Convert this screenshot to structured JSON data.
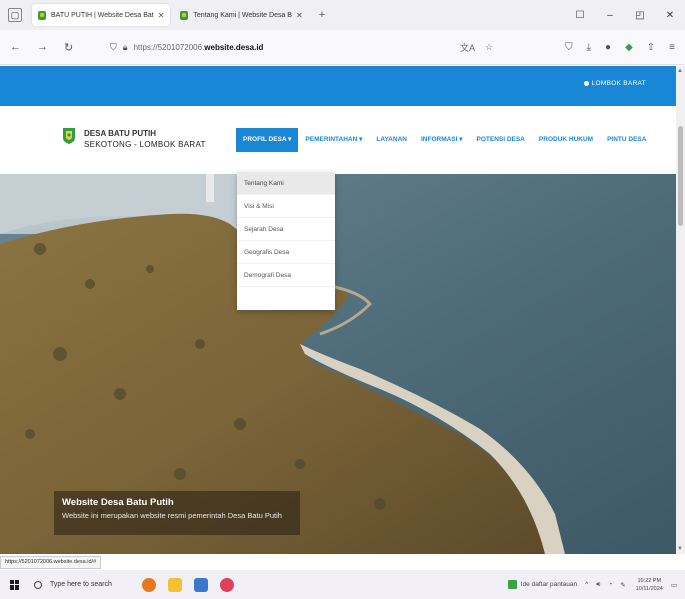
{
  "browser": {
    "tabs": [
      {
        "title": "BATU PUTIH | Website Desa Bat",
        "active": true
      },
      {
        "title": "Tentang Kami | Website Desa B",
        "active": false
      }
    ],
    "new_tab": "+",
    "url_prefix": "https://5201072006.",
    "url_host": "website.desa.id",
    "window_controls": [
      "–",
      "☐",
      "✕"
    ],
    "status_url": "https://5201072006.website.desa.id/#"
  },
  "site": {
    "region": "LOMBOK BARAT",
    "brand_line1": "DESA BATU PUTIH",
    "brand_line2": "SEKOTONG - LOMBOK BARAT",
    "menu": [
      {
        "label": "PROFIL DESA ▾",
        "active": true
      },
      {
        "label": "PEMERINTAHAN ▾",
        "active": false
      },
      {
        "label": "LAYANAN",
        "active": false
      },
      {
        "label": "INFORMASI ▾",
        "active": false
      },
      {
        "label": "POTENSI DESA",
        "active": false
      },
      {
        "label": "PRODUK HUKUM",
        "active": false
      },
      {
        "label": "PINTU DESA",
        "active": false
      }
    ],
    "dropdown": [
      {
        "label": "Tentang Kami",
        "hover": true
      },
      {
        "label": "Visi & Misi",
        "hover": false
      },
      {
        "label": "Sejarah Desa",
        "hover": false
      },
      {
        "label": "Geografis Desa",
        "hover": false
      },
      {
        "label": "Demografi Desa",
        "hover": false
      }
    ],
    "hero_title": "Website Desa Batu Putih",
    "hero_subtitle": "Website ini merupakan website resmi pemerintah Desa Batu Putih"
  },
  "taskbar": {
    "search_placeholder": "Type here to search",
    "news": "Ide daftar pantauan",
    "time": "10:22 PM",
    "date": "10/11/2024"
  },
  "colors": {
    "accent": "#1a86d6",
    "taskbar": "#f2f0f6"
  }
}
